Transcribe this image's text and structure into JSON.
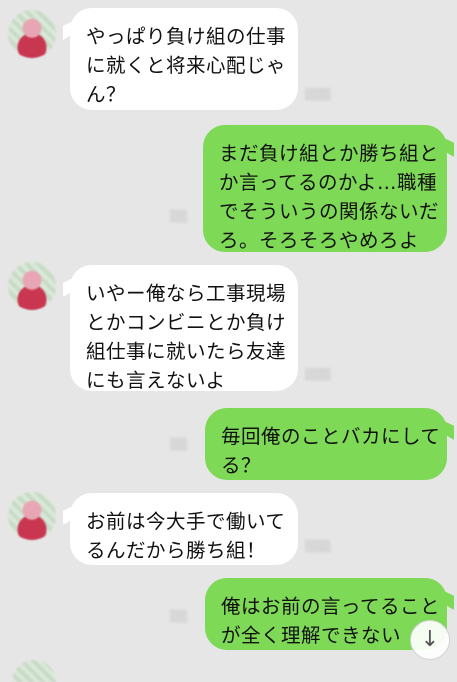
{
  "messages": [
    {
      "side": "in",
      "lines": [
        "やっぱり負け組の仕事",
        "に就くと将来心配じゃ",
        "ん？"
      ]
    },
    {
      "side": "out",
      "lines": [
        "まだ負け組とか勝ち組と",
        "か言ってるのかよ…職種",
        "でそういうの関係ないだ",
        "ろ。そろそろやめろよ"
      ]
    },
    {
      "side": "in",
      "lines": [
        "いやー俺なら工事現場",
        "とかコンビニとか負け",
        "組仕事に就いたら友達",
        "にも言えないよ"
      ]
    },
    {
      "side": "out",
      "lines": [
        "毎回俺のことバカにして",
        "る？"
      ]
    },
    {
      "side": "in",
      "lines": [
        "お前は今大手で働いて",
        "るんだから勝ち組！"
      ]
    },
    {
      "side": "out",
      "lines": [
        "俺はお前の言ってること",
        "が全く理解できない"
      ]
    }
  ],
  "icons": {
    "scroll_down": "↓"
  }
}
